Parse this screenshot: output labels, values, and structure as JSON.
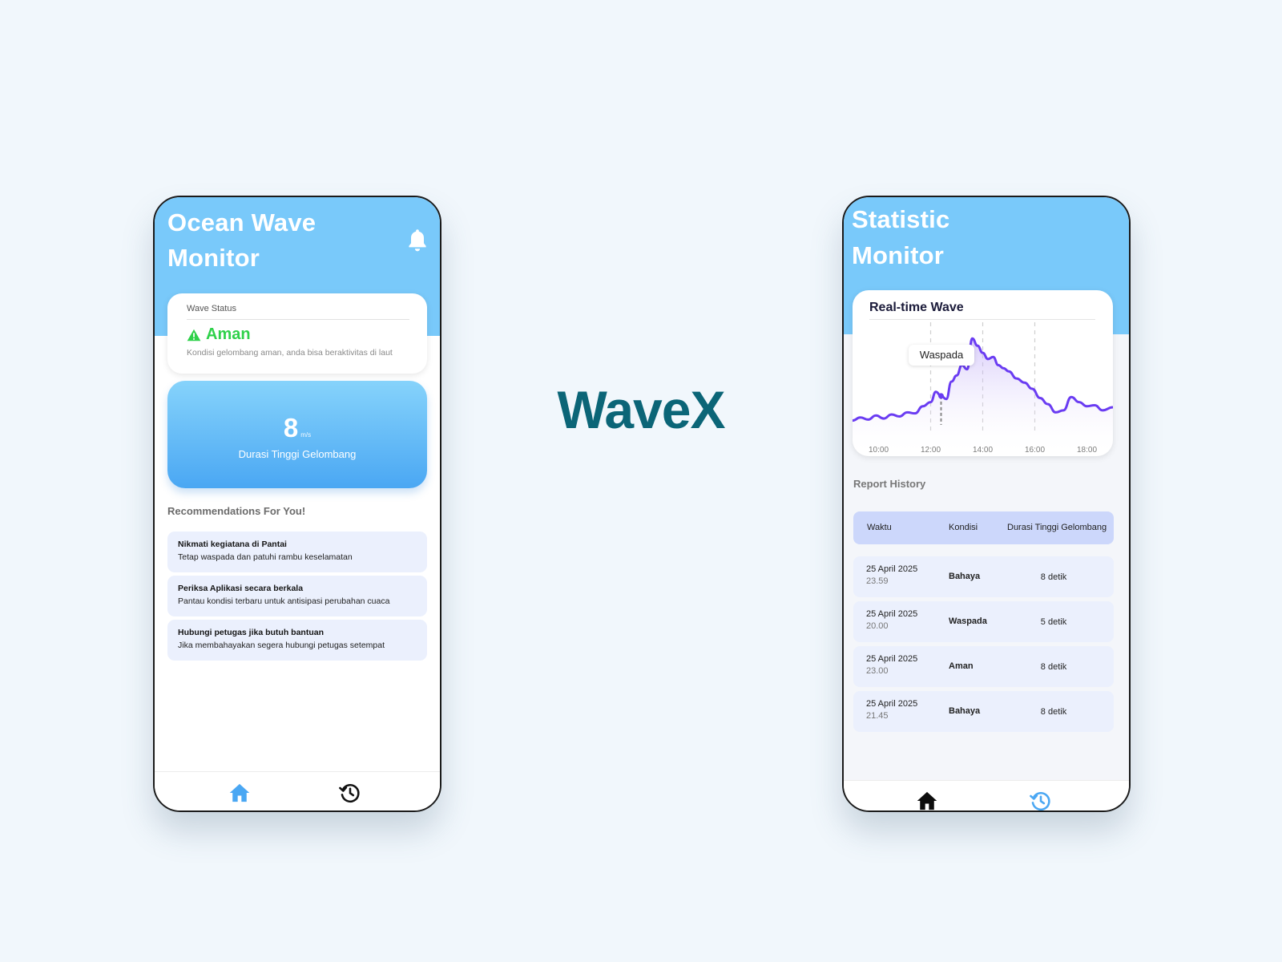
{
  "brand": "WaveX",
  "colors": {
    "header_blue": "#79c9fa",
    "safe_green": "#2fd14a",
    "brand_teal": "#0b6577",
    "chart_line": "#6a3cf2",
    "card_tint": "#ebf0fd"
  },
  "home": {
    "title_line1": "Ocean Wave",
    "title_line2": "Monitor",
    "bell_icon": "bell-icon",
    "status_card": {
      "label": "Wave Status",
      "value": "Aman",
      "icon": "warning-triangle-icon",
      "description": "Kondisi gelombang aman, anda bisa beraktivitas di laut"
    },
    "wave_card": {
      "value": "8",
      "unit": "m/s",
      "caption": "Durasi Tinggi Gelombang"
    },
    "recommendations_title": "Recommendations For You!",
    "recommendations": [
      {
        "title": "Nikmati kegiatana di Pantai",
        "subtitle": "Tetap waspada dan patuhi rambu keselamatan"
      },
      {
        "title": "Periksa Aplikasi secara berkala",
        "subtitle": "Pantau kondisi terbaru untuk antisipasi perubahan cuaca"
      },
      {
        "title": "Hubungi petugas jika butuh bantuan",
        "subtitle": "Jika membahayakan segera hubungi petugas setempat"
      }
    ],
    "nav": {
      "home_icon": "home-icon",
      "history_icon": "history-icon",
      "active": "home"
    }
  },
  "stats": {
    "title_line1": "Statistic",
    "title_line2": "Monitor",
    "chart_title": "Real-time Wave",
    "tooltip_label": "Waspada",
    "report_title": "Report History",
    "table_headers": [
      "Waktu",
      "Kondisi",
      "Durasi Tinggi Gelombang"
    ],
    "rows": [
      {
        "date": "25 April 2025",
        "time": "23.59",
        "condition": "Bahaya",
        "duration": "8 detik"
      },
      {
        "date": "25 April 2025",
        "time": "20.00",
        "condition": "Waspada",
        "duration": "5 detik"
      },
      {
        "date": "25 April 2025",
        "time": "23.00",
        "condition": "Aman",
        "duration": "8 detik"
      },
      {
        "date": "25 April 2025",
        "time": "21.45",
        "condition": "Bahaya",
        "duration": "8 detik"
      }
    ],
    "nav": {
      "home_icon": "home-icon",
      "history_icon": "history-icon",
      "active": "history"
    }
  },
  "chart_data": {
    "type": "area",
    "title": "Real-time Wave",
    "x_tick_labels": [
      "10:00",
      "12:00",
      "14:00",
      "16:00",
      "18:00"
    ],
    "x_range_hours": [
      9.0,
      19.0
    ],
    "grid": "vertical dashed lines at 12:00, 14:00, 16:00",
    "x": [
      9.0,
      9.3,
      9.6,
      9.9,
      10.2,
      10.5,
      10.8,
      11.1,
      11.4,
      11.7,
      12.0,
      12.2,
      12.4,
      12.6,
      12.8,
      13.0,
      13.2,
      13.4,
      13.6,
      13.8,
      14.0,
      14.2,
      14.4,
      14.6,
      14.8,
      15.0,
      15.3,
      15.6,
      15.9,
      16.2,
      16.5,
      16.8,
      17.1,
      17.4,
      17.7,
      18.0,
      18.3,
      18.6,
      19.0
    ],
    "y": [
      0.12,
      0.15,
      0.13,
      0.17,
      0.14,
      0.18,
      0.16,
      0.2,
      0.19,
      0.26,
      0.3,
      0.4,
      0.36,
      0.33,
      0.5,
      0.56,
      0.66,
      0.62,
      0.92,
      0.85,
      0.78,
      0.72,
      0.74,
      0.66,
      0.63,
      0.6,
      0.53,
      0.49,
      0.43,
      0.34,
      0.28,
      0.2,
      0.22,
      0.35,
      0.3,
      0.26,
      0.27,
      0.22,
      0.25
    ],
    "y_range": [
      0,
      1
    ],
    "highlight": {
      "x": 12.4,
      "label": "Waspada"
    }
  }
}
